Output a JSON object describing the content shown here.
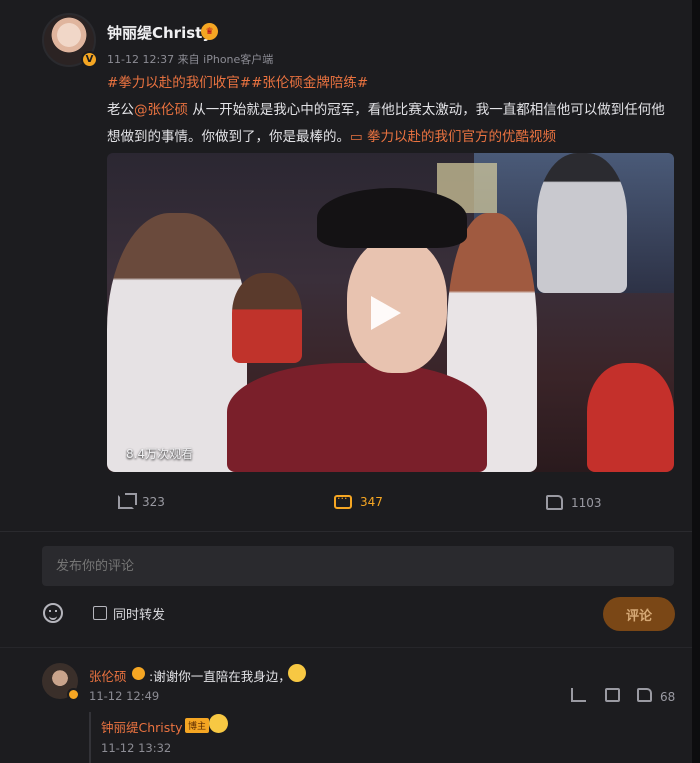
{
  "post": {
    "author_name": "钟丽缇Christy",
    "meta": "11-12 12:37  来自 iPhone客户端",
    "tags": "#拳力以赴的我们收官##张伦硕金牌陪练#",
    "text_prefix": "老公",
    "mention": "@张伦硕",
    "text_body": " 从一开始就是我心中的冠军，看他比赛太激动，我一直都相信他可以做到任何他想做到的事情。你做到了，你是最棒的。",
    "video_link": "拳力以赴的我们官方的优酷视频",
    "video": {
      "view_count": "8.4万次观看"
    },
    "actions": {
      "share_count": "323",
      "comment_count": "347",
      "like_count": "1103"
    }
  },
  "composer": {
    "placeholder": "发布你的评论",
    "repost_label": "同时转发",
    "submit_label": "评论"
  },
  "comments": [
    {
      "name": "张伦硕",
      "text": ":谢谢你一直陪在我身边，",
      "time": "11-12 12:49",
      "likes": "68",
      "reply": {
        "name": "钟丽缇Christy",
        "badge": "博主",
        "time": "11-12 13:32"
      }
    }
  ],
  "colors": {
    "accent": "#eb7340",
    "gold": "#f5a623",
    "background": "#1c1c1f"
  },
  "icons": [
    "share-icon",
    "comment-icon",
    "like-icon",
    "emoji-icon",
    "play-icon",
    "verified-icon",
    "crown-icon"
  ]
}
